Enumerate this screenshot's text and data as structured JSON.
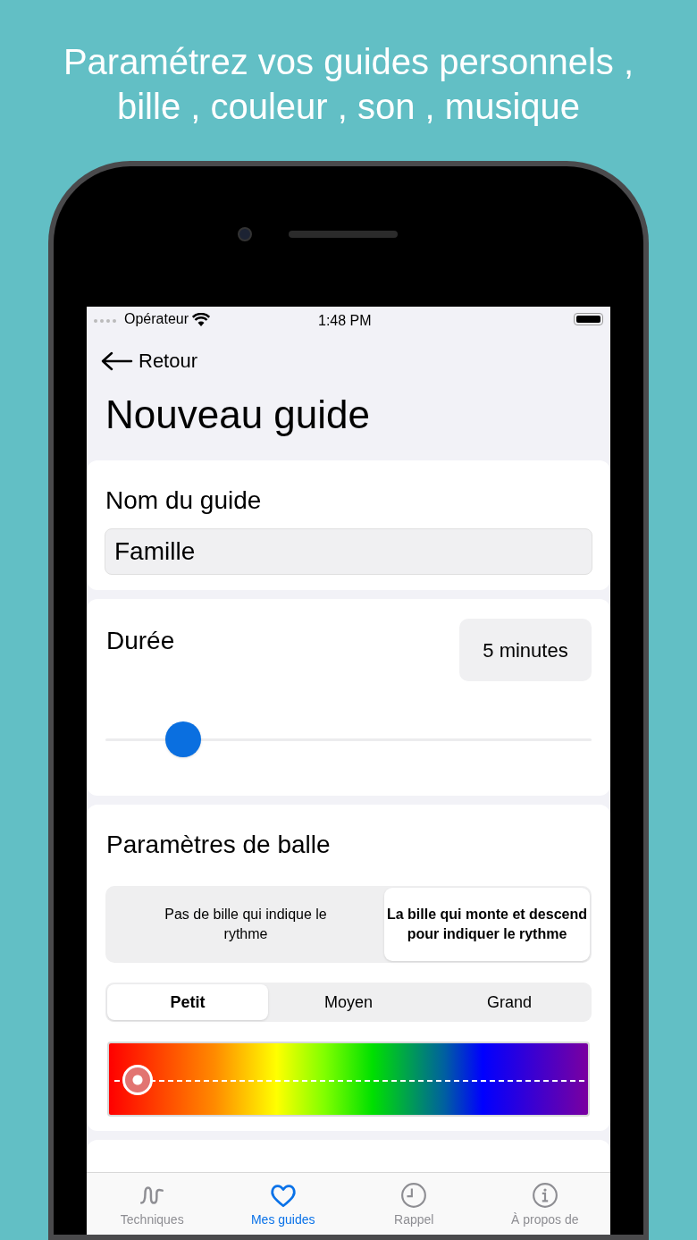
{
  "headline": "Paramétrez vos guides personnels , bille , couleur , son , musique",
  "status_bar": {
    "carrier": "Opérateur",
    "time": "1:48 PM"
  },
  "nav": {
    "back": "Retour",
    "title": "Nouveau guide"
  },
  "name_card": {
    "label": "Nom du guide",
    "value": "Famille"
  },
  "duration_card": {
    "label": "Durée",
    "value": "5 minutes",
    "level": 0.16
  },
  "ball_card": {
    "label": "Paramètres de balle",
    "modes": [
      {
        "label": "Pas de bille qui indique le rythme",
        "selected": false
      },
      {
        "label": "La bille qui monte et descend pour indiquer le rythme",
        "selected": true
      }
    ],
    "sizes": [
      {
        "label": "Petit",
        "selected": true
      },
      {
        "label": "Moyen",
        "selected": false
      },
      {
        "label": "Grand",
        "selected": false
      }
    ],
    "color_slider": {
      "level": 0.03
    }
  },
  "tabs": [
    {
      "label": "Techniques",
      "kind": "wave",
      "selected": false
    },
    {
      "label": "Mes guides",
      "kind": "heart",
      "selected": true
    },
    {
      "label": "Rappel",
      "kind": "clock",
      "selected": false
    },
    {
      "label": "À propos de",
      "kind": "info",
      "selected": false
    }
  ]
}
